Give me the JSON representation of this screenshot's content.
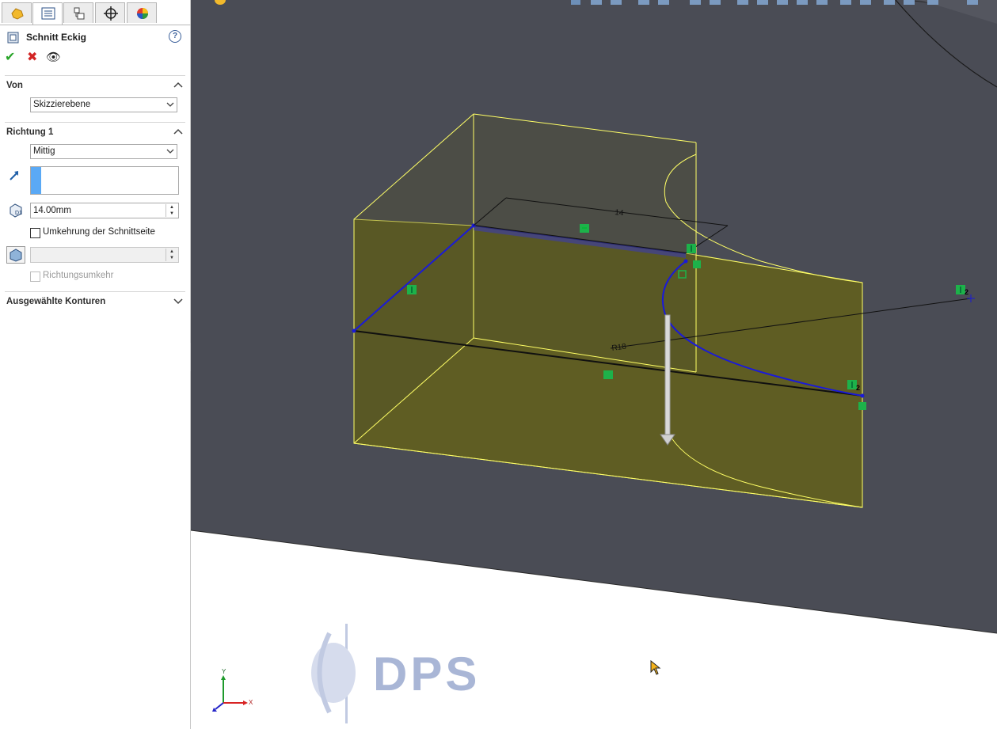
{
  "panel": {
    "title": "Schnitt Eckig",
    "help_label": "?",
    "tabs": [
      {
        "icon": "feature-manager-icon"
      },
      {
        "icon": "property-manager-icon"
      },
      {
        "icon": "configuration-manager-icon"
      },
      {
        "icon": "dimxpert-manager-icon"
      },
      {
        "icon": "display-manager-icon"
      }
    ],
    "actions": {
      "ok": "✔",
      "cancel": "✖",
      "preview": "👁"
    },
    "von": {
      "header": "Von",
      "selected": "Skizzierebene"
    },
    "richtung1": {
      "header": "Richtung 1",
      "end_condition": "Mittig",
      "depth_value": "14.00mm",
      "flip_side_label": "Umkehrung der Schnittseite",
      "flip_side_checked": false,
      "draft_value": "",
      "direction_reverse_label": "Richtungsumkehr",
      "direction_reverse_checked": false
    },
    "contours": {
      "header": "Ausgewählte Konturen"
    }
  },
  "viewport": {
    "background_color": "#4a4c55",
    "floor_color": "#ffffff",
    "cut_fill_color": "#6b6b1f",
    "edge_color": "#ffff66",
    "sketch_color": "#1a1ad8",
    "dimension_labels": [
      "14",
      "R18"
    ],
    "relation_number": "2",
    "triad": {
      "x_label": "X",
      "y_label": "Y"
    }
  },
  "watermark": {
    "text": "DPS",
    "color": "#a9b6d6"
  }
}
